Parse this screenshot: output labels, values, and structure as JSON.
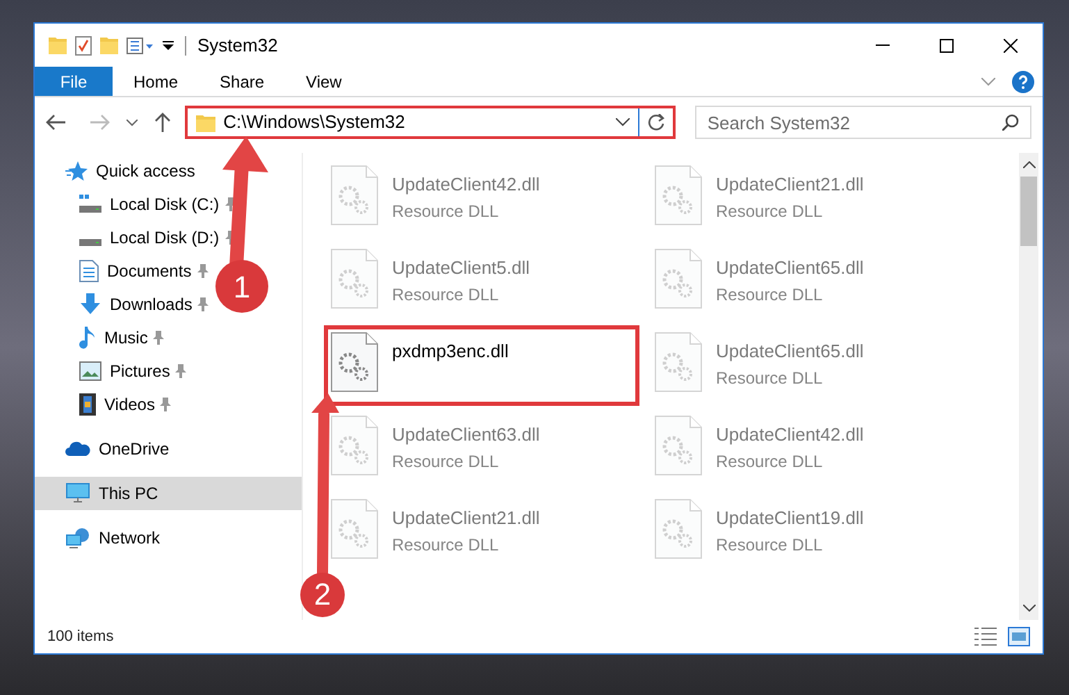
{
  "window": {
    "title": "System32"
  },
  "ribbon_tabs": [
    {
      "label": "File",
      "selected": true
    },
    {
      "label": "Home",
      "selected": false
    },
    {
      "label": "Share",
      "selected": false
    },
    {
      "label": "View",
      "selected": false
    }
  ],
  "address_bar": {
    "path": "C:\\Windows\\System32",
    "highlighted": true
  },
  "search": {
    "placeholder": "Search System32"
  },
  "navigation": [
    {
      "label": "Quick access",
      "selected": false,
      "children": [
        {
          "label": "Local Disk (C:)",
          "pinned": true
        },
        {
          "label": "Local Disk (D:)",
          "pinned": true
        },
        {
          "label": "Documents",
          "pinned": true
        },
        {
          "label": "Downloads",
          "pinned": true
        },
        {
          "label": "Music",
          "pinned": true
        },
        {
          "label": "Pictures",
          "pinned": true
        },
        {
          "label": "Videos",
          "pinned": true
        }
      ]
    },
    {
      "label": "OneDrive",
      "selected": false
    },
    {
      "label": "This PC",
      "selected": true
    },
    {
      "label": "Network",
      "selected": false
    }
  ],
  "files": [
    {
      "name": "UpdateClient42.dll",
      "type": "Resource DLL",
      "blurred": true
    },
    {
      "name": "UpdateClient21.dll",
      "type": "Resource DLL",
      "blurred": true
    },
    {
      "name": "UpdateClient5.dll",
      "type": "Resource DLL",
      "blurred": true
    },
    {
      "name": "UpdateClient65.dll",
      "type": "Resource DLL",
      "blurred": true
    },
    {
      "name": "pxdmp3enc.dll",
      "blurred": false,
      "highlighted": true
    },
    {
      "name": "UpdateClient65.dll",
      "type": "Resource DLL",
      "blurred": true
    },
    {
      "name": "UpdateClient63.dll",
      "type": "Resource DLL",
      "blurred": true
    },
    {
      "name": "UpdateClient42.dll",
      "type": "Resource DLL",
      "blurred": true
    },
    {
      "name": "UpdateClient21.dll",
      "type": "Resource DLL",
      "blurred": true
    },
    {
      "name": "UpdateClient19.dll",
      "type": "Resource DLL",
      "blurred": true
    }
  ],
  "status_bar": {
    "item_count": "100 items"
  },
  "annotations": [
    {
      "number": "1"
    },
    {
      "number": "2"
    }
  ]
}
